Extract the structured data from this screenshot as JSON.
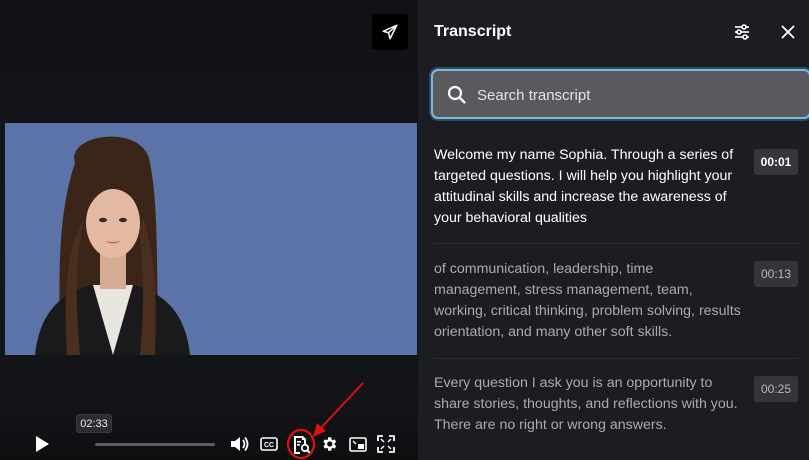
{
  "player": {
    "hover_time": "02:33",
    "progress": 0.0
  },
  "transcript": {
    "title": "Transcript",
    "search_placeholder": "Search transcript",
    "segments": [
      {
        "text": "Welcome my name Sophia. Through a series of targeted questions. I will help you highlight your attitudinal skills and increase the awareness of your behavioral qualities",
        "time": "00:01",
        "active": true
      },
      {
        "text": "of communication, leadership, time management, stress management, team, working, critical thinking, problem solving, results orientation, and many other soft skills.",
        "time": "00:13",
        "active": false
      },
      {
        "text": "Every question I ask you is an opportunity to share stories, thoughts, and reflections with you. There are no right or wrong answers.",
        "time": "00:25",
        "active": false
      }
    ]
  },
  "colors": {
    "accent_focus": "#7fb9d9",
    "annotation_red": "#e01010",
    "video_background": "#5b73a7"
  },
  "icons": {
    "share": "send-icon",
    "play": "play-icon",
    "volume": "volume-icon",
    "captions": "cc-icon",
    "transcript": "transcript-search-icon",
    "settings": "gear-icon",
    "pip": "picture-in-picture-icon",
    "fullscreen": "fullscreen-icon",
    "transcript_settings": "sliders-icon",
    "close": "close-icon",
    "search": "search-icon"
  }
}
